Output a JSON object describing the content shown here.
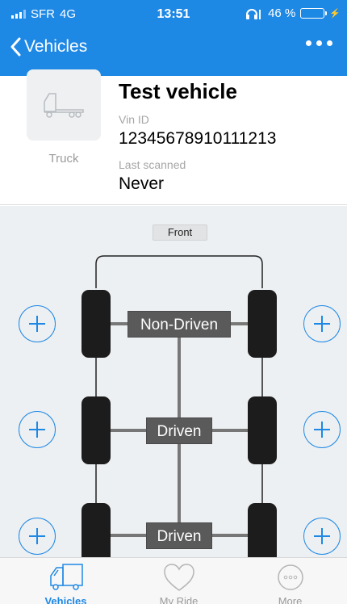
{
  "status_bar": {
    "carrier": "SFR",
    "network": "4G",
    "time": "13:51",
    "battery_percent": "46 %",
    "battery_level": 0.46
  },
  "nav": {
    "back_label": "Vehicles",
    "more_icon": "ellipsis-icon"
  },
  "vehicle": {
    "name": "Test vehicle",
    "type": "Truck",
    "vin_label": "Vin ID",
    "vin": "12345678910111213",
    "last_scanned_label": "Last scanned",
    "last_scanned": "Never"
  },
  "diagram": {
    "front_label": "Front",
    "axles": [
      {
        "label": "Non-Driven"
      },
      {
        "label": "Driven"
      },
      {
        "label": "Driven"
      }
    ]
  },
  "tabs": [
    {
      "label": "Vehicles",
      "icon": "truck-icon",
      "active": true
    },
    {
      "label": "My Ride",
      "icon": "heart-icon",
      "active": false
    },
    {
      "label": "More",
      "icon": "more-icon",
      "active": false
    }
  ],
  "colors": {
    "accent": "#1e88e5",
    "tire": "#1c1c1c",
    "axle_label_bg": "#5a5a5a",
    "diagram_bg": "#edf0f2"
  }
}
